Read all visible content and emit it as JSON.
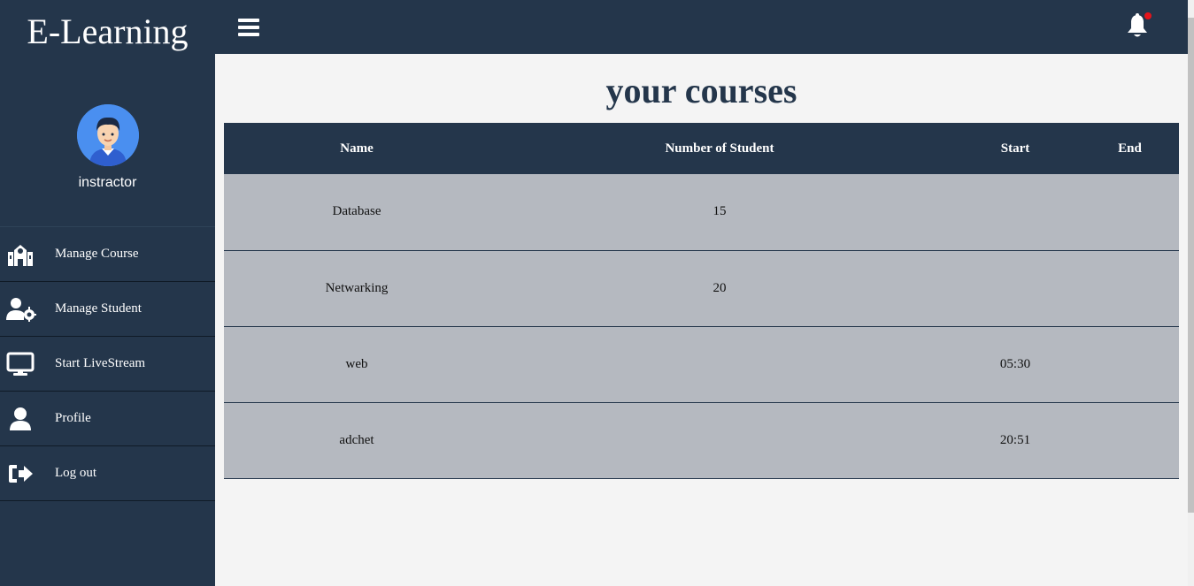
{
  "sidebar": {
    "brand": "E-Learning",
    "profile_name": "instractor",
    "items": [
      {
        "label": "Manage Course",
        "icon": "school-icon"
      },
      {
        "label": "Manage Student",
        "icon": "user-cog-icon"
      },
      {
        "label": "Start LiveStream",
        "icon": "monitor-icon"
      },
      {
        "label": "Profile",
        "icon": "user-icon"
      },
      {
        "label": "Log out",
        "icon": "logout-icon"
      }
    ]
  },
  "topbar": {
    "menu_icon": "hamburger-icon",
    "notification_icon": "bell-icon"
  },
  "main": {
    "title": "your courses",
    "table": {
      "headers": [
        "Name",
        "Number of Student",
        "Start",
        "End"
      ],
      "rows": [
        [
          "Database",
          "15",
          "",
          ""
        ],
        [
          "Netwarking",
          "20",
          "",
          ""
        ],
        [
          "web",
          "",
          "05:30",
          ""
        ],
        [
          "adchet",
          "",
          "20:51",
          ""
        ]
      ]
    }
  },
  "colors": {
    "sidebar_bg": "#24364b",
    "row_bg": "#b5b9c0",
    "page_bg": "#f4f4f4",
    "notification_dot": "#e3141b",
    "avatar_bg": "#4a8ff0"
  }
}
